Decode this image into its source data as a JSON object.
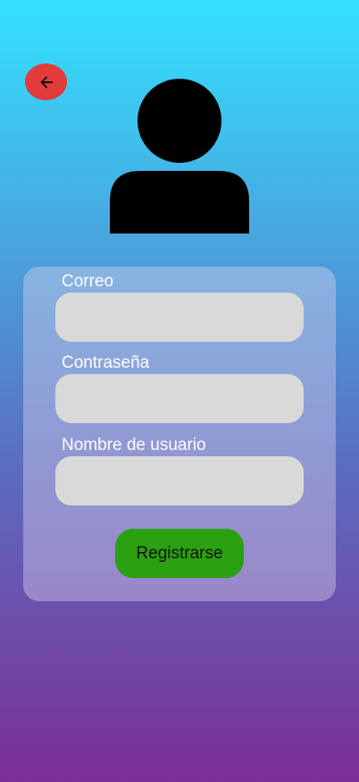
{
  "colors": {
    "gradient_top": "#33e2ff",
    "gradient_mid": "#5b6fc1",
    "gradient_bottom": "#7c2e96",
    "back_button": "#e13b3b",
    "input_background": "#d9d9d9",
    "submit_button": "#2ba010"
  },
  "header": {
    "back_icon": "arrow-left-icon",
    "avatar_icon": "user-silhouette-icon"
  },
  "form": {
    "fields": [
      {
        "label": "Correo",
        "value": "",
        "placeholder": ""
      },
      {
        "label": "Contraseña",
        "value": "",
        "placeholder": ""
      },
      {
        "label": "Nombre de usuario",
        "value": "",
        "placeholder": ""
      }
    ],
    "submit_label": "Registrarse"
  }
}
